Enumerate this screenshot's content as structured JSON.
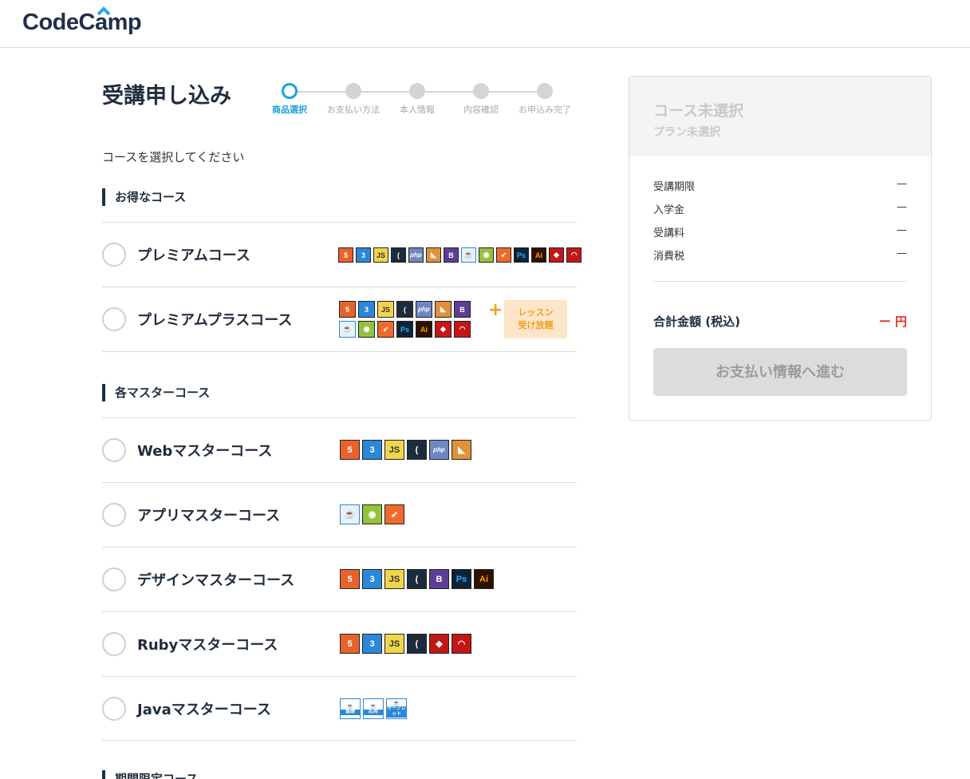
{
  "header": {
    "logo_text_1": "CodeC",
    "logo_text_2": "mp"
  },
  "page": {
    "title": "受講申し込み",
    "instruction": "コースを選択してください"
  },
  "steps": [
    {
      "label": "商品選択",
      "active": true
    },
    {
      "label": "お支払い方法",
      "active": false
    },
    {
      "label": "本人情報",
      "active": false
    },
    {
      "label": "内容確認",
      "active": false
    },
    {
      "label": "お申込み完了",
      "active": false
    }
  ],
  "sections": {
    "deals": "お得なコース",
    "masters": "各マスターコース",
    "limited": "期間限定コース"
  },
  "courses": {
    "premium": "プレミアムコース",
    "premium_plus": "プレミアムプラスコース",
    "web": "Webマスターコース",
    "app": "アプリマスターコース",
    "design": "デザインマスターコース",
    "ruby": "Rubyマスターコース",
    "java": "Javaマスターコース"
  },
  "icon_text": {
    "html": "5",
    "css": "3",
    "js": "JS",
    "jquery": "(",
    "php": "php",
    "sass": "◣",
    "bootstrap": "B",
    "java": "☕",
    "android": "◉",
    "swift": "➶",
    "ps": "Ps",
    "ai": "Ai",
    "ruby": "◆",
    "rails": "◠"
  },
  "java_badges": [
    "基礎",
    "応用",
    "サーブレット"
  ],
  "lesson_badge": {
    "line1": "レッスン",
    "line2": "受け放題",
    "plus": "+"
  },
  "summary": {
    "course": "コース未選択",
    "plan": "プラン未選択",
    "rows": [
      {
        "label": "受講期限",
        "value": "—"
      },
      {
        "label": "入学金",
        "value": "—"
      },
      {
        "label": "受講料",
        "value": "—"
      },
      {
        "label": "消費税",
        "value": "—"
      }
    ],
    "total_label": "合計金額 (税込)",
    "total_value": "ー 円",
    "pay_button": "お支払い情報へ進む"
  }
}
